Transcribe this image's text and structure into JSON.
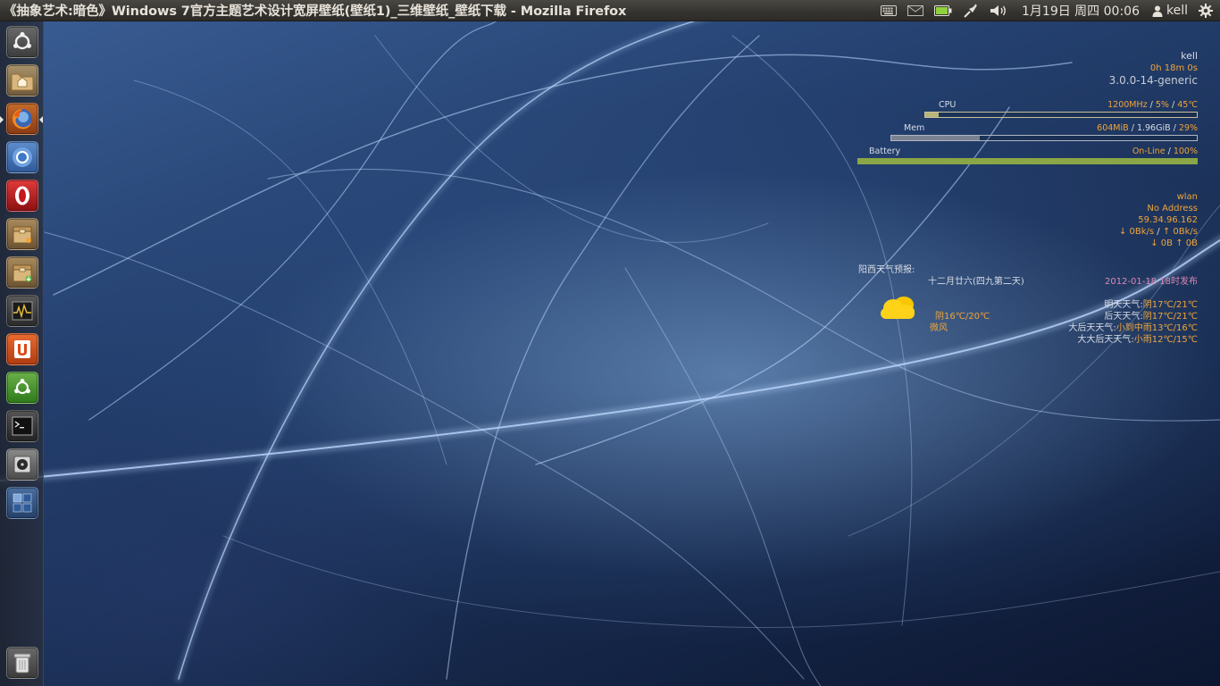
{
  "window": {
    "title": "《抽象艺术:暗色》Windows 7官方主题艺术设计宽屏壁纸(壁纸1)_三维壁纸_壁纸下载 - Mozilla Firefox"
  },
  "panel": {
    "indicators": [
      "keyboard-icon",
      "mail-icon",
      "battery-icon",
      "network-icon",
      "volume-icon"
    ],
    "clock": "1月19日 周四 00:06",
    "user": "kell",
    "colors": {
      "panel": "#3b3a36",
      "battery_indicator": "#8fd13c"
    }
  },
  "launcher": {
    "items": [
      {
        "name": "ubuntu-dash",
        "icon": "ubuntu-logo-icon",
        "active": false
      },
      {
        "name": "home-folder",
        "icon": "home-folder-icon",
        "active": false
      },
      {
        "name": "firefox",
        "icon": "firefox-icon",
        "active": true
      },
      {
        "name": "chromium",
        "icon": "chromium-icon",
        "active": false
      },
      {
        "name": "opera",
        "icon": "opera-icon",
        "active": false
      },
      {
        "name": "archive-manager",
        "icon": "archive-box-icon",
        "active": false
      },
      {
        "name": "package-installer",
        "icon": "package-install-icon",
        "active": false
      },
      {
        "name": "system-monitor",
        "icon": "system-monitor-icon",
        "active": false
      },
      {
        "name": "ubuntu-one",
        "icon": "ubuntu-one-icon",
        "active": false
      },
      {
        "name": "ubuntu-software-center",
        "icon": "software-center-icon",
        "active": false
      },
      {
        "name": "terminal",
        "icon": "terminal-icon",
        "active": false
      },
      {
        "name": "disk-utility",
        "icon": "disk-icon",
        "active": false
      },
      {
        "name": "workspace-switcher",
        "icon": "workspace-switcher-icon",
        "active": false
      },
      {
        "name": "trash",
        "icon": "trash-icon",
        "active": false
      }
    ]
  },
  "conky": {
    "username": "kell",
    "uptime": "0h 18m 0s",
    "kernel": "3.0.0-14-generic",
    "cpu": {
      "label": "CPU",
      "freq": "1200MHz",
      "sep1": "/",
      "usage": "5%",
      "sep2": "/",
      "temp": "45℃",
      "fill": 0.05
    },
    "mem": {
      "label": "Mem",
      "used": "604MiB",
      "sep1": "/",
      "total": "1.96GiB",
      "sep2": "/",
      "percent": "29%",
      "fill": 0.29
    },
    "battery": {
      "label": "Battery",
      "status": "On-Line",
      "sep": "/",
      "percent": "100%",
      "fill": 1.0
    },
    "net": {
      "iface": "wlan",
      "address": "No Address",
      "public_ip": "59.34.96.162",
      "down_speed": "↓ 0Bk/s",
      "up_speed": "↑ 0Bk/s",
      "speed_sep": "/",
      "down_total": "↓ 0B",
      "up_total": "↑ 0B"
    },
    "colors": {
      "label": "#d8dde6",
      "value": "#f0a43a",
      "publish": "#d888b4",
      "battery_bar": "#8aa646"
    }
  },
  "weather": {
    "title": "阳西天气预报:",
    "lunar_date": "十二月廿六(四九第二天)",
    "published": "2012-01-18 18时发布",
    "today_cond": "阴16℃/20℃",
    "today_wind": "微风",
    "icon": "cloudy-icon",
    "forecast": [
      {
        "label": "明天天气:",
        "value": "阴17℃/21℃"
      },
      {
        "label": "后天天气:",
        "value": "阴17℃/21℃"
      },
      {
        "label": "大后天天气:",
        "value": "小到中雨13℃/16℃"
      },
      {
        "label": "大大后天天气:",
        "value": "小雨12℃/15℃"
      }
    ]
  }
}
